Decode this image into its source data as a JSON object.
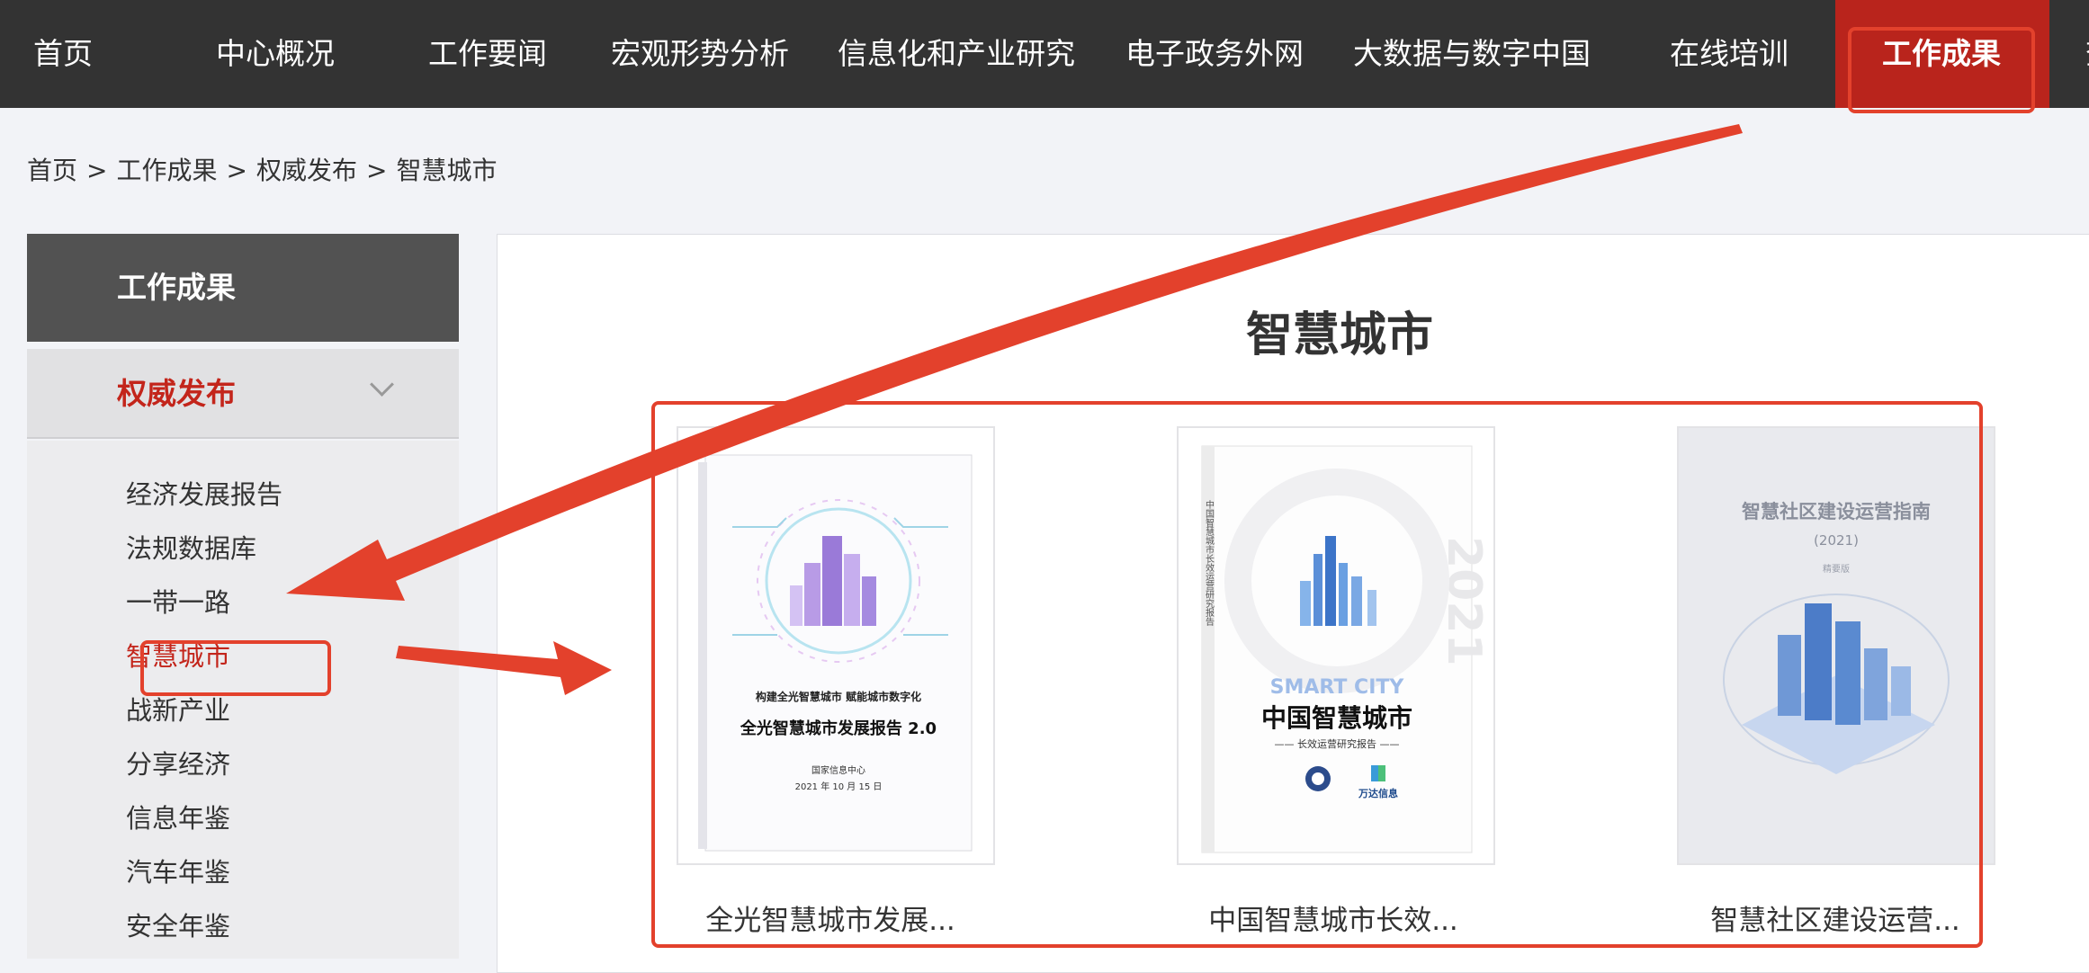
{
  "nav": {
    "items": [
      "首页",
      "中心概况",
      "工作要闻",
      "宏观形势分析",
      "信息化和产业研究",
      "电子政务外网",
      "大数据与数字中国",
      "在线培训",
      "工作成果"
    ],
    "active": "工作成果",
    "partial": "查"
  },
  "breadcrumb": {
    "items": [
      "首页",
      "工作成果",
      "权威发布",
      "智慧城市"
    ],
    "separator": ">"
  },
  "sidebar": {
    "header": "工作成果",
    "section": "权威发布",
    "items": [
      "经济发展报告",
      "法规数据库",
      "一带一路",
      "智慧城市",
      "战新产业",
      "分享经济",
      "信息年鉴",
      "汽车年鉴",
      "安全年鉴"
    ],
    "current": "智慧城市"
  },
  "main": {
    "title": "智慧城市",
    "reports": [
      {
        "title": "全光智慧城市发展...",
        "cover": {
          "slogan": "构建全光智慧城市   赋能城市数字化",
          "name": "全光智慧城市发展报告 2.0",
          "org": "国家信息中心",
          "date": "2021 年 10 月 15 日"
        }
      },
      {
        "title": "中国智慧城市长效...",
        "cover": {
          "year": "2021",
          "english": "SMART CITY",
          "name": "中国智慧城市",
          "subtitle": "—— 长效运营研究报告 ——",
          "spine": "中国智慧城市长效运营研究报告",
          "brand": "万达信息"
        }
      },
      {
        "title": "智慧社区建设运营...",
        "cover": {
          "name": "智慧社区建设运营指南",
          "year": "(2021)",
          "edition": "精要版"
        }
      }
    ]
  },
  "colors": {
    "nav_bg": "#333333",
    "accent": "#c3251b",
    "annotation": "#e3412c"
  }
}
